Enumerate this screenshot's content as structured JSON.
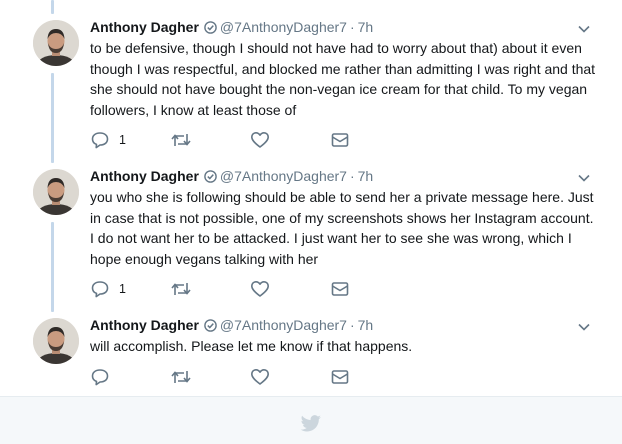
{
  "colors": {
    "thread_line": "#c4d7ea",
    "icon": "#657786",
    "footer_bg": "#f5f8fa",
    "footer_bird": "#ccd6dd"
  },
  "tweets": [
    {
      "name": "Anthony Dagher",
      "handle": "@7AnthonyDagher7",
      "separator": "·",
      "time": "7h",
      "text": "to be defensive, though I should not have had to worry about that) about it even though I was respectful, and blocked me rather than admitting I was right and that she should not have bought the non-vegan ice cream for that child. To my vegan followers, I know at least those of",
      "reply_count": "1",
      "icons": [
        "reply-icon",
        "retweet-icon",
        "like-icon",
        "direct-message-icon"
      ]
    },
    {
      "name": "Anthony Dagher",
      "handle": "@7AnthonyDagher7",
      "separator": "·",
      "time": "7h",
      "text": "you who she is following should be able to send her a private message here. Just in case that is not possible, one of my screenshots shows her Instagram account. I do not want her to be attacked. I just want her to see she was wrong, which I hope enough vegans talking with her",
      "reply_count": "1",
      "icons": [
        "reply-icon",
        "retweet-icon",
        "like-icon",
        "direct-message-icon"
      ]
    },
    {
      "name": "Anthony Dagher",
      "handle": "@7AnthonyDagher7",
      "separator": "·",
      "time": "7h",
      "text": "will accomplish. Please let me know if that happens.",
      "reply_count": "",
      "icons": [
        "reply-icon",
        "retweet-icon",
        "like-icon",
        "direct-message-icon"
      ]
    }
  ],
  "footer": {
    "icon": "twitter-bird-icon"
  }
}
